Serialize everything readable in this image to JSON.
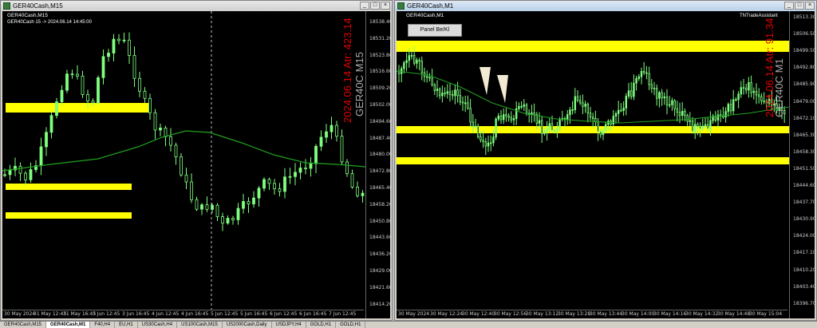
{
  "left_window": {
    "title": "GER40Cash,M15",
    "symbol_label": "GER40Cash,M15",
    "info_line": "GER40Cash 15 -> 2024.06.14 14:45:00",
    "overlay_date": "2024.06.14 Atr: 423.14",
    "overlay_symbol": "GER40C M15",
    "y_labels": [
      "18538.40",
      "18531.20",
      "18523.80",
      "18516.60",
      "18509.20",
      "18502.00",
      "18494.60",
      "18487.40",
      "18480.00",
      "18472.80",
      "18465.40",
      "18458.20",
      "18450.80",
      "18443.60",
      "18436.20",
      "18429.00",
      "18421.60",
      "18414.20"
    ],
    "x_labels": [
      "30 May 2024",
      "31 May 12:45",
      "31 May 16:45",
      "3 Jun 12:45",
      "3 Jun 16:45",
      "4 Jun 12:45",
      "4 Jun 16:45",
      "5 Jun 12:45",
      "5 Jun 16:45",
      "6 Jun 12:45",
      "6 Jun 16:45",
      "7 Jun 12:45"
    ]
  },
  "right_window": {
    "title": "GER40Cash,M1",
    "symbol_label": "GER40Cash,M1",
    "indicator_label": "TNTradeAssistant",
    "panel_button": "Panel Be/Kl",
    "overlay_date": "2024.06.14 Atr: 91.34",
    "overlay_symbol": "GER40C M1",
    "y_labels": [
      "18513.30",
      "18506.50",
      "18499.50",
      "18492.80",
      "18485.90",
      "18479.00",
      "18472.10",
      "18465.30",
      "18458.30",
      "18451.50",
      "18444.60",
      "18437.70",
      "18430.90",
      "18424.00",
      "18417.10",
      "18410.20",
      "18403.40",
      "18396.70"
    ],
    "x_labels": [
      "30 May 2024",
      "30 May 12:24",
      "30 May 12:40",
      "30 May 12:56",
      "30 May 13:12",
      "30 May 13:28",
      "30 May 13:44",
      "30 May 14:00",
      "30 May 14:16",
      "30 May 14:32",
      "30 May 14:48",
      "30 May 15:04"
    ]
  },
  "tabs": [
    "GER40Cash,M15",
    "GER40Cash,M1",
    "F40,H4",
    "EU,H1",
    "US30Cash,H4",
    "US100Cash,M15",
    "US2000Cash,Daily",
    "USDJPY,H4",
    "GOLD,H1",
    "GOLD,H1"
  ],
  "colors": {
    "zone": "#ffff00",
    "candle": "#7fff7f",
    "ma": "#1fa21f",
    "overlay_red": "#e00000",
    "overlay_gray": "#aaaaaa"
  }
}
